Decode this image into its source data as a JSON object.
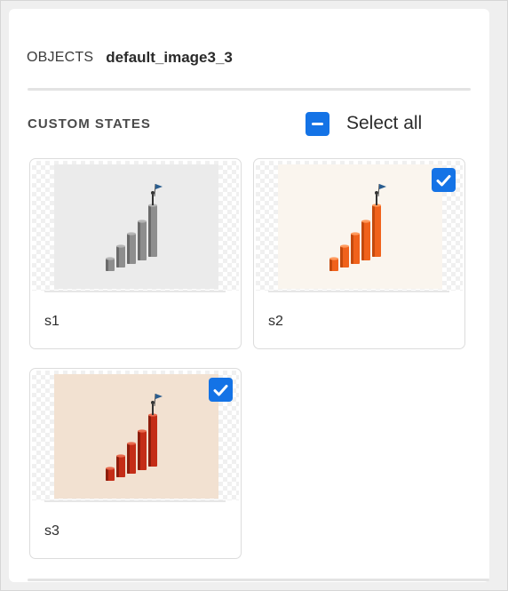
{
  "header": {
    "kicker": "OBJECTS",
    "object_name": "default_image3_3"
  },
  "custom_states": {
    "title": "CUSTOM STATES",
    "select_all_label": "Select all",
    "items": [
      {
        "name": "s1",
        "selected": false,
        "bg": "#ebebeb",
        "bar": "#8e8e8e",
        "bar_dark": "#6a6a6a",
        "bar_top": "#b5b5b5"
      },
      {
        "name": "s2",
        "selected": true,
        "bg": "#faf5ee",
        "bar": "#f0621b",
        "bar_dark": "#c44a0d",
        "bar_top": "#ff9a5d"
      },
      {
        "name": "s3",
        "selected": true,
        "bg": "#f2e1d1",
        "bar": "#c42d17",
        "bar_dark": "#8d1d0c",
        "bar_top": "#e86a4e"
      }
    ]
  },
  "colors": {
    "accent": "#1473e6"
  }
}
